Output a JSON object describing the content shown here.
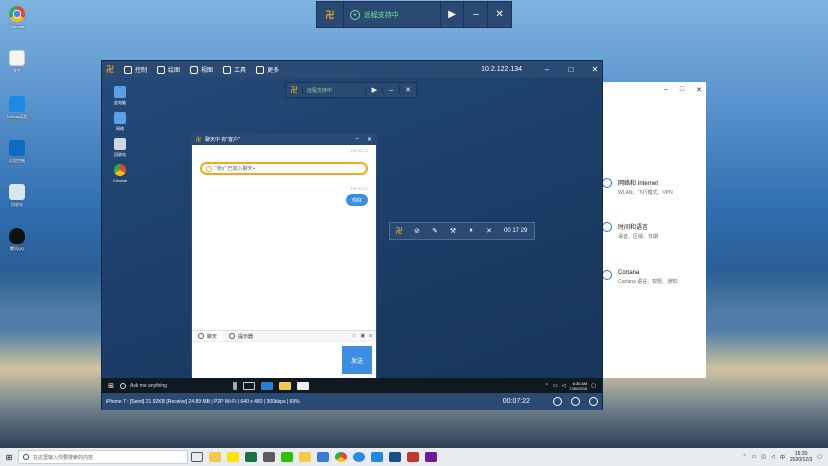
{
  "desktop": {
    "icons": [
      {
        "label": "Chrome",
        "color": "#e8eaed"
      },
      {
        "label": "文件",
        "color": "#f5f5f5"
      },
      {
        "label": "ToDesk远程",
        "color": "#1e88e5"
      },
      {
        "label": "远程控制",
        "color": "#0f6dbf"
      },
      {
        "label": "回收站",
        "color": "#d9e4ee"
      },
      {
        "label": "腾讯QQ",
        "color": "#111111"
      }
    ]
  },
  "top_bar": {
    "logo": "卍",
    "status": "远程支持中",
    "play": "▶",
    "minimize": "–",
    "close": "✕"
  },
  "remote_window": {
    "logo": "卍",
    "menu": [
      "控制",
      "绘图",
      "视图",
      "工具",
      "更多"
    ],
    "ip": "10.2.122.134",
    "controls": [
      "–",
      "□",
      "✕"
    ],
    "desktop_icons": [
      {
        "label": "此电脑",
        "color": "#5aa0e6"
      },
      {
        "label": "网络",
        "color": "#5aa0e6"
      },
      {
        "label": "回收站",
        "color": "#cfd8e3"
      },
      {
        "label": "Chrome",
        "color": "#f0b400"
      }
    ],
    "inner_bar": {
      "logo": "卍",
      "status": "远程支持中",
      "play": "▶",
      "minimize": "–",
      "close": "✕"
    },
    "float_bar": {
      "logo": "卍",
      "time": "00 17 29",
      "pause": "⏸",
      "close": "✕"
    },
    "chat": {
      "logo": "卍",
      "title": "聊天中 有\"客户\"",
      "controls": [
        "–",
        "✕"
      ],
      "time1": "PM 02:10",
      "system_message": "\"张x\" 已加入聊天+",
      "time2": "PM 02:10",
      "bubble": "你好",
      "tab_chat": "聊天",
      "tab_tips": "提示器",
      "send": "发送"
    },
    "taskbar": {
      "search": "Ask me anything",
      "clock_time": "6:30 AM",
      "clock_date": "7/30/2015"
    },
    "status": {
      "info": "iPhone 7 : [Send] 21.92KB  [Receive] 24.89 MB | P2P Wi-Fi | 640 x 480 | 300kbps | 69%",
      "time": "00:07:22"
    }
  },
  "settings": {
    "controls": [
      "–",
      "□",
      "✕"
    ],
    "items": [
      {
        "title": "网络和 Internet",
        "sub": "WLAN、飞行模式、VPN"
      },
      {
        "title": "时间和语言",
        "sub": "语音、区域、日期"
      },
      {
        "title": "Cortana",
        "sub": "Cortana 语言、权限、通知"
      }
    ]
  },
  "host_taskbar": {
    "search": "在这里输入你要搜索的内容",
    "clock_time": "16:20",
    "clock_date": "2020/12/3"
  }
}
